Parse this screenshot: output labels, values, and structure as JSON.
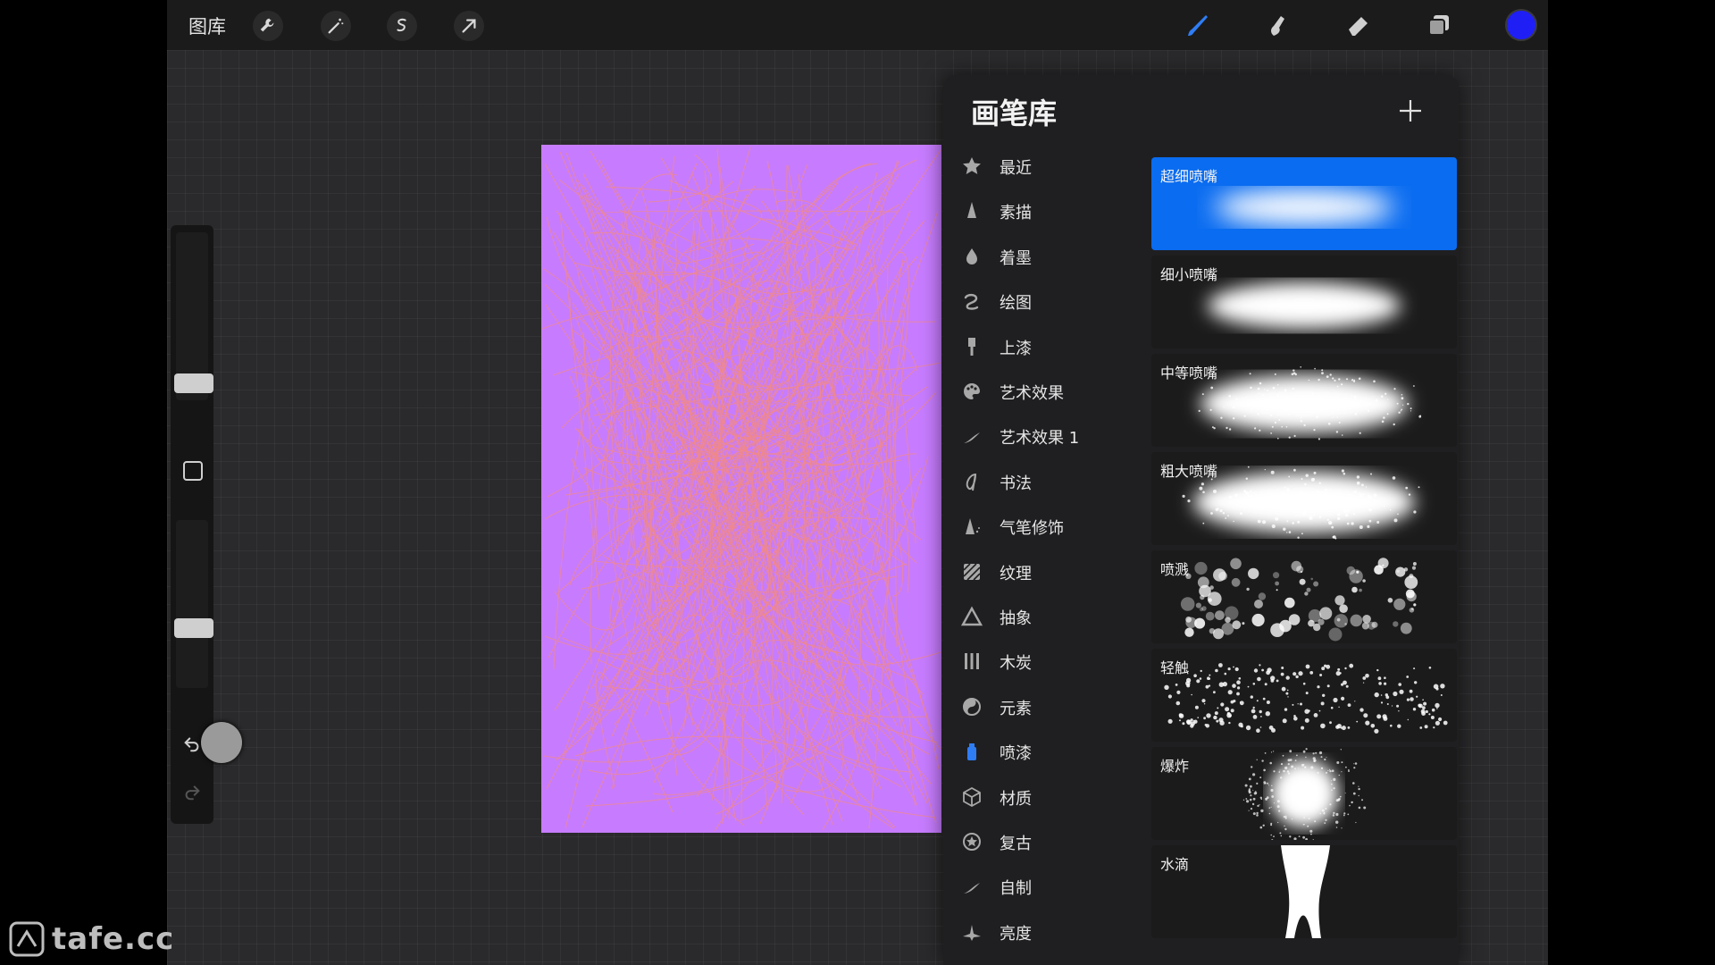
{
  "toolbar": {
    "gallery_label": "图库",
    "left_icons": [
      "wrench-icon",
      "magic-wand-icon",
      "selection-icon",
      "transform-arrow-icon"
    ],
    "right_icons": [
      "brush-icon",
      "smudge-icon",
      "eraser-icon",
      "layers-icon"
    ],
    "active_color": "#1f1ff5"
  },
  "sidebar": {
    "brush_size_level": 0.55,
    "opacity_level": 0.4,
    "undo_icon": "undo-icon",
    "redo_icon": "redo-icon"
  },
  "artwork": {
    "background_color": "#c77cff",
    "stroke_color": "#f08a8a"
  },
  "brush_library": {
    "title": "画笔库",
    "categories": [
      {
        "label": "最近",
        "icon": "star-icon"
      },
      {
        "label": "素描",
        "icon": "pencil-tip-icon"
      },
      {
        "label": "着墨",
        "icon": "ink-drop-icon"
      },
      {
        "label": "绘图",
        "icon": "curl-icon"
      },
      {
        "label": "上漆",
        "icon": "paint-brush-icon"
      },
      {
        "label": "艺术效果",
        "icon": "palette-icon"
      },
      {
        "label": "艺术效果 1",
        "icon": "feather-stroke-icon"
      },
      {
        "label": "书法",
        "icon": "calligraphy-icon"
      },
      {
        "label": "气笔修饰",
        "icon": "airbrush-icon"
      },
      {
        "label": "纹理",
        "icon": "texture-icon"
      },
      {
        "label": "抽象",
        "icon": "triangle-icon"
      },
      {
        "label": "木炭",
        "icon": "charcoal-icon"
      },
      {
        "label": "元素",
        "icon": "yin-yang-icon"
      },
      {
        "label": "喷漆",
        "icon": "spray-can-icon"
      },
      {
        "label": "材质",
        "icon": "cube-icon"
      },
      {
        "label": "复古",
        "icon": "badge-star-icon"
      },
      {
        "label": "自制",
        "icon": "feather-stroke-icon"
      },
      {
        "label": "亮度",
        "icon": "sparkle-icon"
      }
    ],
    "brushes": [
      {
        "name": "超细喷嘴",
        "selected": true
      },
      {
        "name": "细小喷嘴",
        "selected": false
      },
      {
        "name": "中等喷嘴",
        "selected": false
      },
      {
        "name": "粗大喷嘴",
        "selected": false
      },
      {
        "name": "喷溅",
        "selected": false
      },
      {
        "name": "轻触",
        "selected": false
      },
      {
        "name": "爆炸",
        "selected": false
      },
      {
        "name": "水滴",
        "selected": false
      }
    ]
  },
  "watermark": {
    "text": "tafe.cc"
  }
}
